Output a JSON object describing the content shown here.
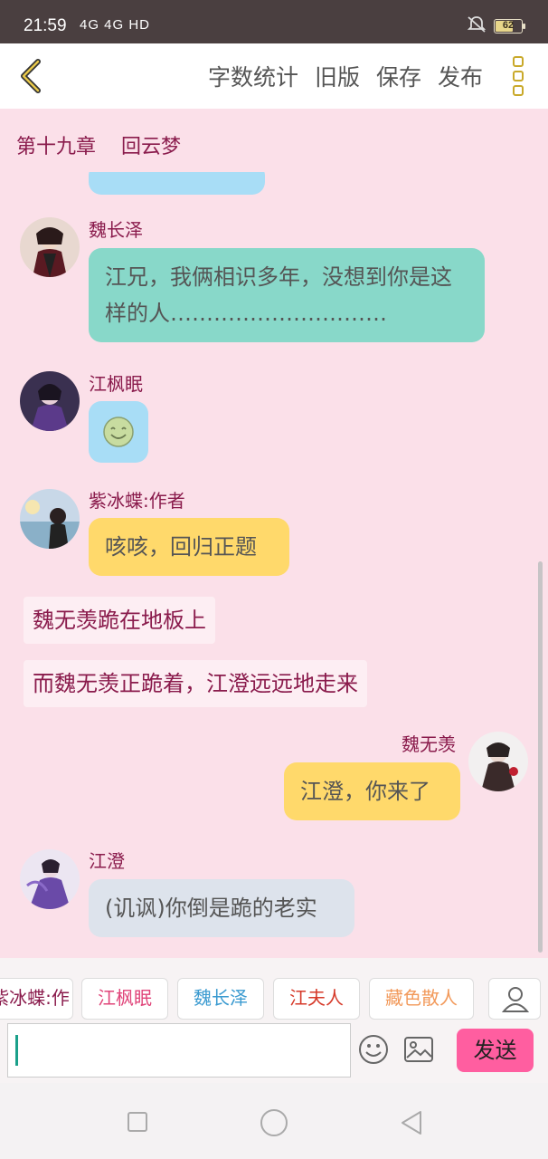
{
  "status_bar": {
    "time": "21:59",
    "signal": "4G 4G HD",
    "battery": "62",
    "battery_level": 0.62
  },
  "top_bar": {
    "actions": [
      "字数统计",
      "旧版",
      "保存",
      "发布"
    ]
  },
  "chapter": {
    "number": "第十九章",
    "title": "回云梦"
  },
  "messages": [
    {
      "sender": "魏长泽",
      "text": "江兄，我俩相识多年，没想到你是这样的人…………………………",
      "color": "teal"
    },
    {
      "sender": "江枫眠",
      "text": "",
      "emoji": "smile",
      "color": "blue"
    },
    {
      "sender": "紫冰蝶:作者",
      "text": "咳咳，回归正题",
      "color": "yellow"
    },
    {
      "narration": "魏无羡跪在地板上"
    },
    {
      "narration": "而魏无羡正跪着，江澄远远地走来"
    },
    {
      "sender": "魏无羡",
      "text": "江澄，你来了",
      "color": "yellow",
      "side": "right"
    },
    {
      "sender": "江澄",
      "text": "(讥讽)你倒是跪的老实",
      "color": "gray"
    }
  ],
  "characters": [
    {
      "name": "紫冰蝶:作者",
      "color": "#8a1b4c"
    },
    {
      "name": "江枫眠",
      "color": "#e0457a"
    },
    {
      "name": "魏长泽",
      "color": "#3a9ad0"
    },
    {
      "name": "江夫人",
      "color": "#d63a2a"
    },
    {
      "name": "藏色散人",
      "color": "#f2995a"
    }
  ],
  "input": {
    "value": "",
    "send_label": "发送"
  },
  "colors": {
    "background": "#fbe0e9",
    "accent": "#8a1b4c",
    "send": "#ff5ea0",
    "teal_bubble": "#88d8c9",
    "blue_bubble": "#a8ddf6",
    "yellow_bubble": "#ffd96b",
    "gray_bubble": "#dde3ec"
  },
  "icons": [
    "back-chevron-icon",
    "more-icon",
    "smiley-icon",
    "image-icon",
    "user-icon",
    "nav-square-icon",
    "nav-circle-icon",
    "nav-triangle-icon"
  ]
}
